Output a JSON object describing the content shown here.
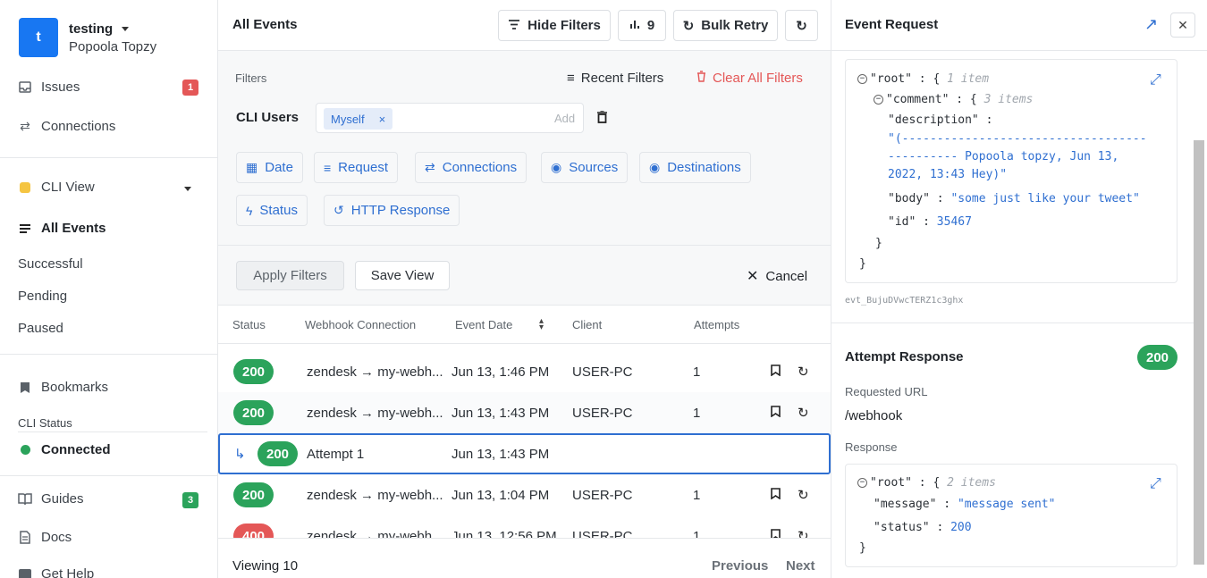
{
  "colors": {
    "accent": "#1877f2",
    "success": "#2ba35b",
    "danger": "#e45757",
    "link": "#2f6fd1",
    "badge_red": "#e45757",
    "badge_green": "#2ba35b"
  },
  "sidebar": {
    "org_initial": "t",
    "org_name": "testing",
    "org_user": "Popoola Topzy",
    "issues": {
      "label": "Issues",
      "count": "1"
    },
    "connections": "Connections",
    "view_name": "CLI View",
    "all_events": "All Events",
    "sub": [
      "Successful",
      "Pending",
      "Paused"
    ],
    "bookmarks": "Bookmarks",
    "cli_status_label": "CLI Status",
    "cli_status": "Connected",
    "guides": {
      "label": "Guides",
      "count": "3"
    },
    "docs": "Docs",
    "help": "Get Help"
  },
  "header": {
    "title": "All Events",
    "hide_filters": "Hide Filters",
    "count": "9",
    "bulk_retry": "Bulk Retry"
  },
  "filters": {
    "label": "Filters",
    "recent": "Recent Filters",
    "clear": "Clear All Filters",
    "cli_users_label": "CLI Users",
    "cli_user_tag": "Myself",
    "add_placeholder": "Add",
    "chips": [
      "Date",
      "Request",
      "Connections",
      "Sources",
      "Destinations",
      "Status",
      "HTTP Response"
    ]
  },
  "actions": {
    "apply": "Apply Filters",
    "save": "Save View",
    "cancel": "Cancel"
  },
  "table": {
    "columns": [
      "Status",
      "Webhook Connection",
      "Event Date",
      "Client",
      "Attempts"
    ],
    "rows": [
      {
        "status": "200",
        "connection": "zendesk → my-webh...",
        "date": "Jun 13, 1:46 PM",
        "client": "USER-PC",
        "attempts": "1"
      },
      {
        "status": "200",
        "connection": "zendesk → my-webh...",
        "date": "Jun 13, 1:43 PM",
        "client": "USER-PC",
        "attempts": "1"
      },
      {
        "status": "200",
        "connection": "Attempt 1",
        "date": "Jun 13, 1:43 PM",
        "client": "",
        "attempts": ""
      },
      {
        "status": "200",
        "connection": "zendesk → my-webh...",
        "date": "Jun 13, 1:04 PM",
        "client": "USER-PC",
        "attempts": "1"
      },
      {
        "status": "400",
        "connection": "zendesk → my-webh...",
        "date": "Jun 13, 12:56 PM",
        "client": "USER-PC",
        "attempts": "1"
      }
    ]
  },
  "footer": {
    "viewing": "Viewing 10",
    "previous": "Previous",
    "next": "Next"
  },
  "panel": {
    "title": "Event Request",
    "json1": {
      "root_key": "\"root\"",
      "root_meta": "1 item",
      "comment_key": "\"comment\"",
      "comment_meta": "3 items",
      "desc_key": "\"description\"",
      "desc_val_1": "\"(-----------------------------------",
      "desc_val_2": "---------- Popoola topzy, Jun 13,",
      "desc_val_3": "2022, 13:43 Hey)\"",
      "body_key": "\"body\"",
      "body_val": "\"some just like your tweet\"",
      "id_key": "\"id\"",
      "id_val": "35467"
    },
    "event_id": "evt_BujuDVwcTERZ1c3ghx",
    "attempt_title": "Attempt Response",
    "attempt_status": "200",
    "requested_url_label": "Requested URL",
    "requested_url": "/webhook",
    "response_label": "Response",
    "json2": {
      "root_key": "\"root\"",
      "root_meta": "2 items",
      "message_key": "\"message\"",
      "message_val": "\"message sent\"",
      "status_key": "\"status\"",
      "status_val": "200"
    }
  }
}
